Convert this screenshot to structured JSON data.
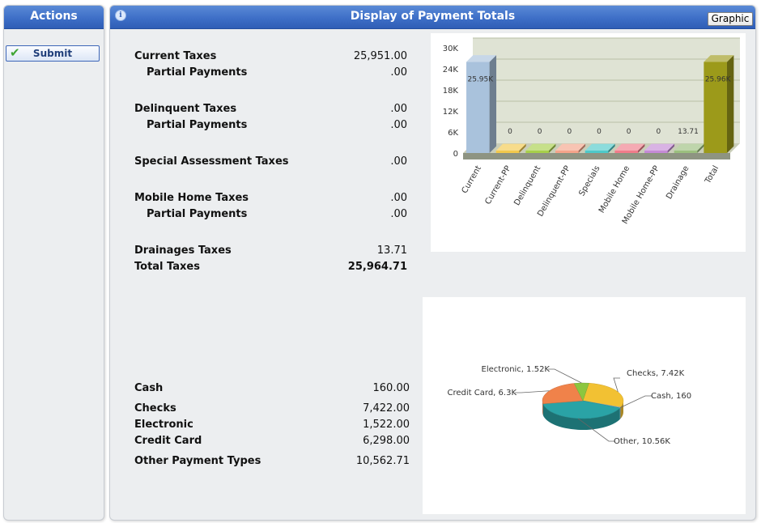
{
  "actions": {
    "title": "Actions",
    "submit_label": "Submit"
  },
  "main": {
    "title": "Display of Payment Totals",
    "graphic_label": "Graphic",
    "info_icon": "i"
  },
  "taxes": [
    {
      "label": "Current Taxes",
      "value": "25,951.00",
      "indent": false
    },
    {
      "label": "Partial Payments",
      "value": ".00",
      "indent": true
    },
    {
      "label": "Delinquent Taxes",
      "value": ".00",
      "indent": false
    },
    {
      "label": "Partial Payments",
      "value": ".00",
      "indent": true
    },
    {
      "label": "Special Assessment Taxes",
      "value": ".00",
      "indent": false
    },
    {
      "label": "Mobile Home Taxes",
      "value": ".00",
      "indent": false
    },
    {
      "label": "Partial Payments",
      "value": ".00",
      "indent": true
    },
    {
      "label": "Drainages Taxes",
      "value": "13.71",
      "indent": false
    },
    {
      "label": "Total Taxes",
      "value": "25,964.71",
      "indent": false
    }
  ],
  "payments": [
    {
      "label": "Cash",
      "value": "160.00"
    },
    {
      "label": "Checks",
      "value": "7,422.00"
    },
    {
      "label": "Electronic",
      "value": "1,522.00"
    },
    {
      "label": "Credit Card",
      "value": "6,298.00"
    },
    {
      "label": "Other Payment Types",
      "value": "10,562.71"
    }
  ],
  "chart_data": [
    {
      "type": "bar",
      "title": "",
      "categories": [
        "Current",
        "Current-PP",
        "Delinquent",
        "Delinquent-PP",
        "Specials",
        "Mobile Home",
        "Mobile Home-PP",
        "Drainage",
        "Total"
      ],
      "values": [
        25951,
        0,
        0,
        0,
        0,
        0,
        0,
        13.71,
        25964.71
      ],
      "data_labels": [
        "25.95K",
        "0",
        "0",
        "0",
        "0",
        "0",
        "0",
        "13.71",
        "25.96K"
      ],
      "y_ticks": [
        "0",
        "6K",
        "12K",
        "18K",
        "24K",
        "30K"
      ],
      "ylim": [
        0,
        30000
      ],
      "grid": true,
      "colors": [
        "#a9c2dc",
        "#f2c94c",
        "#a7cf4a",
        "#f4a48a",
        "#4ec9c9",
        "#f07c8a",
        "#c48ad6",
        "#9bbf7e",
        "#9c9a1a"
      ]
    },
    {
      "type": "pie",
      "title": "",
      "slices": [
        {
          "label": "Checks, 7.42K",
          "value": 7422,
          "color": "#f2c133"
        },
        {
          "label": "Cash, 160",
          "value": 160,
          "color": "#9bbce0"
        },
        {
          "label": "Other, 10.56K",
          "value": 10562.71,
          "color": "#2aa3a6"
        },
        {
          "label": "Credit Card, 6.3K",
          "value": 6298,
          "color": "#f0824a"
        },
        {
          "label": "Electronic, 1.52K",
          "value": 1522,
          "color": "#8cc63f"
        }
      ]
    }
  ]
}
